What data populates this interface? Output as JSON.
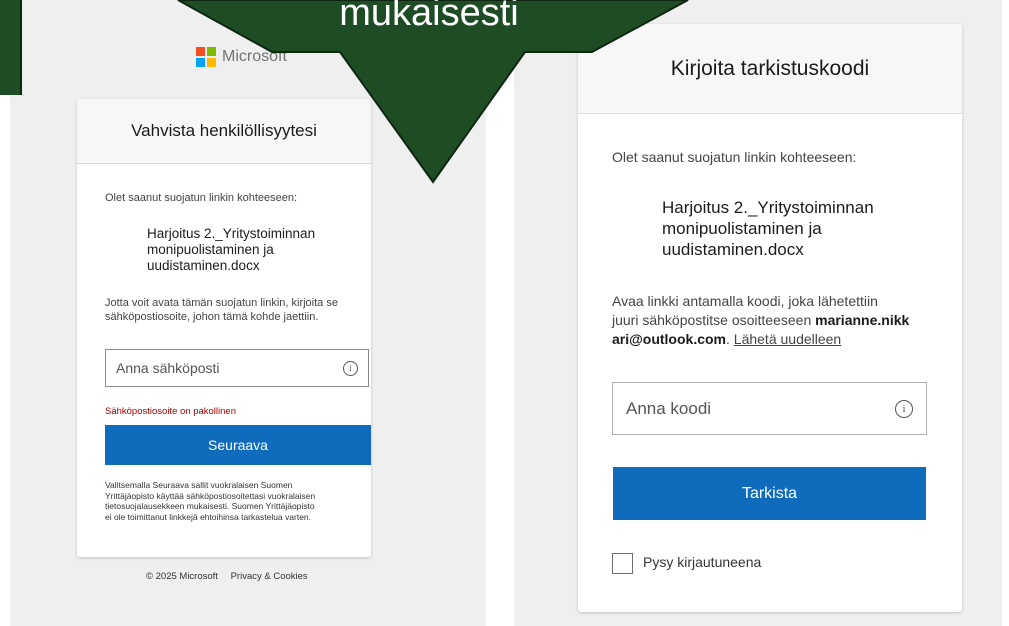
{
  "left": {
    "brand": "Microsoft",
    "brand_colors": [
      "#f25022",
      "#7fba00",
      "#00a4ef",
      "#ffb900"
    ],
    "title": "Vahvista henkilöllisyytesi",
    "intro": "Olet saanut suojatun linkin kohteeseen:",
    "document_lines": [
      "Harjoitus 2._Yritystoiminnan",
      "monipuolistaminen ja",
      "uudistaminen.docx"
    ],
    "instructions_lines": [
      "Jotta voit avata tämän suojatun linkin, kirjoita se",
      "sähköpostiosoite, johon tämä kohde jaettiin."
    ],
    "email_placeholder": "Anna sähköposti",
    "info_icon": "info-icon",
    "error": "Sähköpostiosoite on pakollinen",
    "next_button": "Seuraava",
    "legal_lines": [
      "Valitsemalla Seuraava sallit vuokralaisen Suomen",
      "Yrittäjäopisto käyttää sähköpostiosoitettasi vuokralaisen",
      "tietosuojalausekkeen mukaisesti. Suomen Yrittäjäopisto",
      "ei ole toimittanut linkkejä ehtoihinsa tarkastelua varten."
    ],
    "footer": {
      "copyright": "© 2025 Microsoft",
      "privacy": "Privacy & Cookies"
    }
  },
  "right": {
    "title": "Kirjoita tarkistuskoodi",
    "intro": "Olet saanut suojatun linkin kohteeseen:",
    "document_lines": [
      "Harjoitus 2._Yritystoiminnan",
      "monipuolistaminen ja",
      "uudistaminen.docx"
    ],
    "info_line1": "Avaa linkki antamalla koodi, joka lähetettiin",
    "info_line2_prefix": "juuri sähköpostitse osoitteeseen ",
    "email_part1": "marianne.nikk",
    "email_part2": "ari@outlook.com",
    "resend_separator": ". ",
    "resend_link": "Lähetä uudelleen",
    "code_placeholder": "Anna koodi",
    "verify_button": "Tarkista",
    "stay_signed_in": "Pysy kirjautuneena"
  },
  "overlay": {
    "text": "mukaisesti",
    "color": "#1e4d25"
  },
  "colors": {
    "accent": "#0f6cbd",
    "error": "#a80000"
  }
}
